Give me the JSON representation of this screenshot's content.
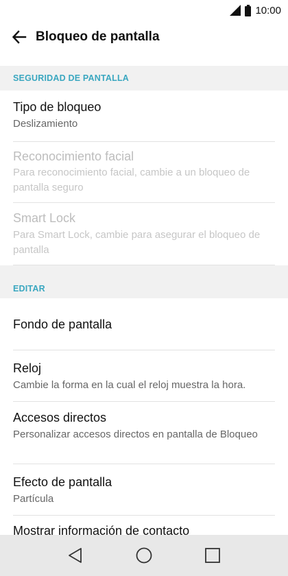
{
  "status_bar": {
    "time": "10:00",
    "icons": [
      "signal-icon",
      "battery-icon"
    ]
  },
  "app_bar": {
    "title": "Bloqueo de pantalla",
    "back_icon": "back-arrow-icon"
  },
  "sections": {
    "seguridad": {
      "header": "SEGURIDAD DE PANTALLA",
      "items": [
        {
          "label": "Tipo de bloqueo",
          "desc": "Deslizamiento",
          "enabled": true
        },
        {
          "label": "Reconocimiento facial",
          "desc": "Para reconocimiento facial, cambie a un bloqueo de pantalla seguro",
          "enabled": false
        },
        {
          "label": "Smart Lock",
          "desc": "Para Smart Lock, cambie para asegurar el bloqueo de pantalla",
          "enabled": false
        }
      ]
    },
    "editar": {
      "header": "EDITAR",
      "items": [
        {
          "label": "Fondo de pantalla",
          "desc": ""
        },
        {
          "label": "Reloj",
          "desc": "Cambie la forma en la cual el reloj muestra la hora."
        },
        {
          "label": "Accesos directos",
          "desc": "Personalizar accesos directos en pantalla de Bloqueo"
        },
        {
          "label": "Efecto de pantalla",
          "desc": "Partícula"
        },
        {
          "label": "Mostrar información de contacto",
          "desc": ""
        }
      ]
    }
  },
  "nav_bar": {
    "buttons": [
      "back-triangle-icon",
      "home-circle-icon",
      "recents-square-icon"
    ]
  },
  "colors": {
    "section_header_text": "#3aa7c0",
    "section_bg": "#f1f1f1",
    "nav_bg": "#e8e8e8"
  }
}
